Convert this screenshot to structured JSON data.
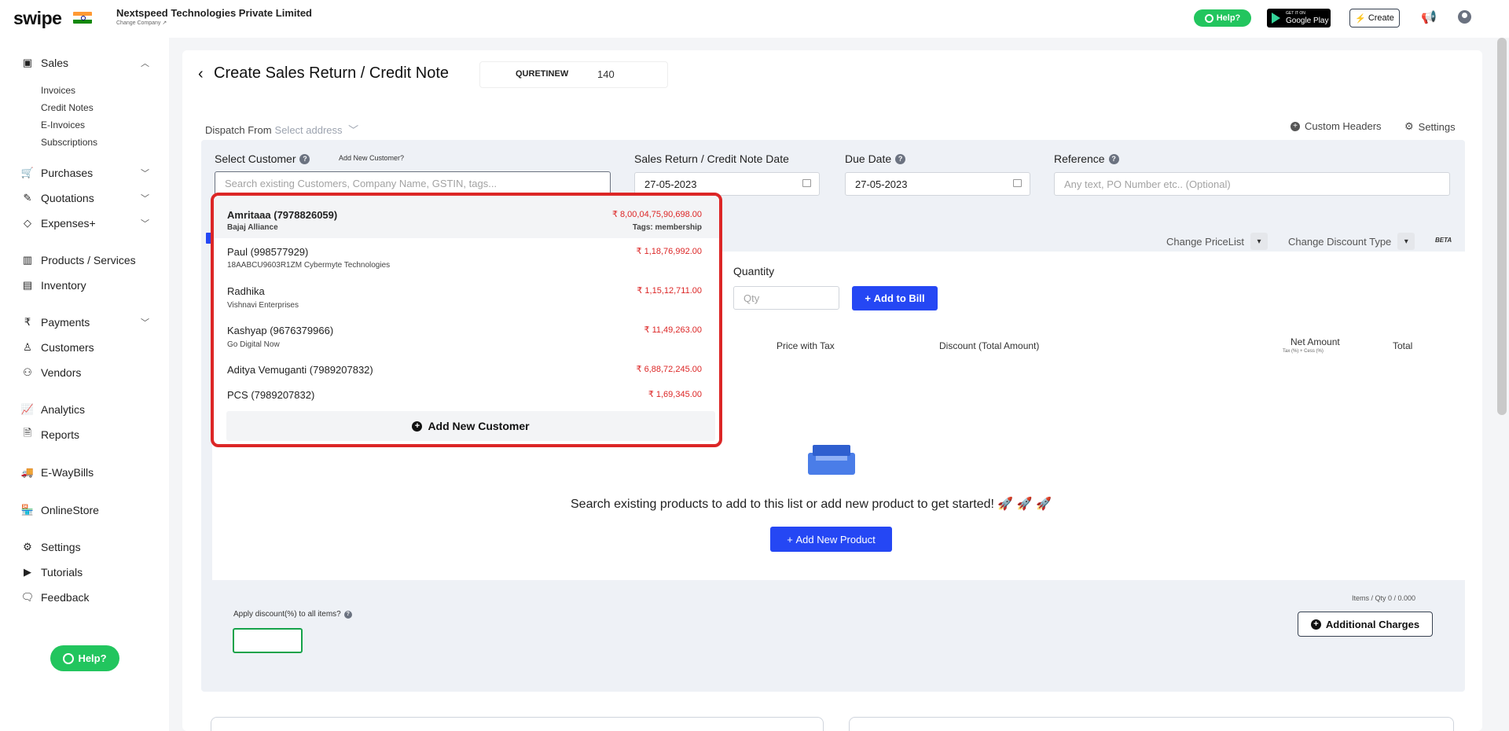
{
  "topbar": {
    "logo": "swipe",
    "company_name": "Nextspeed Technologies Private Limited",
    "change_company": "Change Company ↗",
    "help_label": "Help?",
    "gplay_small": "GET IT ON",
    "gplay_big": "Google Play",
    "create_label": "Create"
  },
  "sidebar": {
    "sales": "Sales",
    "sales_sub": [
      "Invoices",
      "Credit Notes",
      "E-Invoices",
      "Subscriptions"
    ],
    "purchases": "Purchases",
    "quotations": "Quotations",
    "expenses": "Expenses+",
    "products": "Products / Services",
    "inventory": "Inventory",
    "payments": "Payments",
    "customers": "Customers",
    "vendors": "Vendors",
    "analytics": "Analytics",
    "reports": "Reports",
    "ewaybills": "E-WayBills",
    "onlinestore": "OnlineStore",
    "settings": "Settings",
    "tutorials": "Tutorials",
    "feedback": "Feedback",
    "help": "Help?"
  },
  "header": {
    "title": "Create Sales Return / Credit Note",
    "prefix": "QURETINEW",
    "number": "140"
  },
  "dispatch": {
    "label": "Dispatch From",
    "placeholder": "Select address"
  },
  "links": {
    "custom_headers": "Custom Headers",
    "settings": "Settings"
  },
  "form": {
    "select_customer": "Select Customer",
    "add_new_customer_link": "Add New Customer?",
    "customer_placeholder": "Search existing Customers, Company Name, GSTIN, tags...",
    "date_label": "Sales Return / Credit Note Date",
    "date_value": "27-05-2023",
    "due_label": "Due Date",
    "due_value": "27-05-2023",
    "reference_label": "Reference",
    "reference_placeholder": "Any text, PO Number etc.. (Optional)"
  },
  "pricing": {
    "change_pricelist": "Change PriceList",
    "change_discount": "Change Discount Type",
    "beta": "BETA"
  },
  "product_entry": {
    "quantity_label": "Quantity",
    "qty_placeholder": "Qty",
    "add_to_bill": "Add to Bill"
  },
  "table_headers": {
    "price_with_tax": "Price with Tax",
    "discount": "Discount (Total Amount)",
    "net_amount": "Net Amount",
    "net_amount_sub": "Tax (%) + Cess (%)",
    "total": "Total"
  },
  "empty": {
    "message": "Search existing products to add to this list or add new product to get started! 🚀 🚀 🚀",
    "add_product": "Add New Product"
  },
  "footer": {
    "apply_discount": "Apply discount(%) to all items?",
    "items_qty": "Items / Qty 0 / 0.000",
    "additional_charges": "Additional Charges"
  },
  "dropdown": {
    "customers": [
      {
        "name": "Amritaaa (7978826059)",
        "sub": "Bajaj Alliance",
        "amount": "₹ 8,00,04,75,90,698.00",
        "tags": "Tags: membership"
      },
      {
        "name": "Paul (998577929)",
        "sub": "18AABCU9603R1ZM Cybermyte Technologies",
        "amount": "₹ 1,18,76,992.00",
        "tags": ""
      },
      {
        "name": "Radhika",
        "sub": "Vishnavi Enterprises",
        "amount": "₹ 1,15,12,711.00",
        "tags": ""
      },
      {
        "name": "Kashyap (9676379966)",
        "sub": "Go Digital Now",
        "amount": "₹ 11,49,263.00",
        "tags": ""
      },
      {
        "name": "Aditya Vemuganti (7989207832)",
        "sub": "",
        "amount": "₹ 6,88,72,245.00",
        "tags": ""
      },
      {
        "name": "PCS (7989207832)",
        "sub": "",
        "amount": "₹ 1,69,345.00",
        "tags": ""
      }
    ],
    "add_new": "Add New Customer"
  },
  "colors": {
    "accent": "#2547f4",
    "help_green": "#22c55e",
    "amount_red": "#dc2626",
    "highlight_border": "#dc2626"
  }
}
